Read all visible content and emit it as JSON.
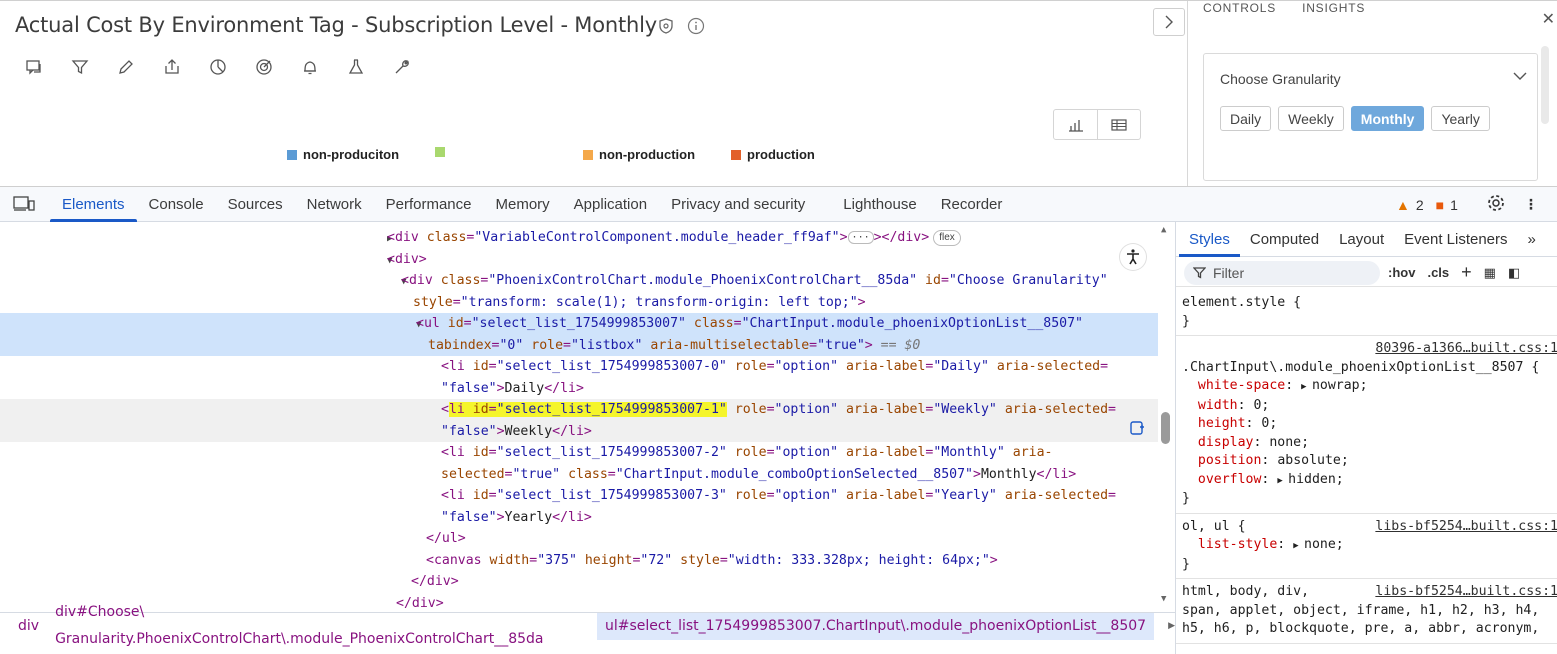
{
  "app": {
    "title": "Actual Cost By Environment Tag - Subscription Level - Monthly",
    "title_icons": [
      "shield-icon",
      "info-icon"
    ],
    "toolbar_icons": [
      "comment-icon",
      "filter-icon",
      "pencil-icon",
      "share-icon",
      "pie-chart-icon",
      "target-icon",
      "bell-icon",
      "flask-icon",
      "wrench-icon"
    ],
    "view_toggle": [
      "bar-chart-icon",
      "table-icon"
    ],
    "legend": [
      {
        "label": "non-produciton",
        "color": "#5b9bd5"
      },
      {
        "label": "",
        "color": "#a9d86e"
      },
      {
        "label": "non-production",
        "color": "#f4a84a"
      },
      {
        "label": "production",
        "color": "#e2602a"
      }
    ]
  },
  "side_panel": {
    "tabs": [
      "CONTROLS",
      "INSIGHTS"
    ],
    "granularity": {
      "label": "Choose Granularity",
      "options": [
        "Daily",
        "Weekly",
        "Monthly",
        "Yearly"
      ],
      "selected": "Monthly"
    }
  },
  "devtools": {
    "tabs": [
      "Elements",
      "Console",
      "Sources",
      "Network",
      "Performance",
      "Memory",
      "Application",
      "Privacy and security",
      "Lighthouse",
      "Recorder"
    ],
    "active_tab": "Elements",
    "warnings": "2",
    "issues": "1",
    "dom": {
      "l1_tag_open": "<div ",
      "l1_attr": "class",
      "l1_val": "\"VariableControlComponent.module_header_ff9af\"",
      "l1_close": "></div>",
      "l1_badge": "flex",
      "l2": "<div>",
      "l3_tag": "<div ",
      "l3_a1": "class",
      "l3_v1": "\"PhoenixControlChart.module_PhoenixControlChart__85da\"",
      "l3_a2": " id",
      "l3_v2": "\"Choose Granularity\"",
      "l4_a": "style",
      "l4_v": "\"transform: scale(1); transform-origin: left top;\"",
      "l5_tag": "<ul ",
      "l5_a1": "id",
      "l5_v1": "\"select_list_1754999853007\"",
      "l5_a2": " class",
      "l5_v2": "\"ChartInput.module_phoenixOptionList__8507\"",
      "l6_a1": "tabindex",
      "l6_v1": "\"0\"",
      "l6_a2": " role",
      "l6_v2": "\"listbox\"",
      "l6_a3": " aria-multiselectable",
      "l6_v3": "\"true\"",
      "l6_sel": " == $0",
      "li0_id": "\"select_list_1754999853007-0\"",
      "li0_label": "\"Daily\"",
      "li0_text": "Daily",
      "li1_id": "\"select_list_1754999853007-1\"",
      "li1_label": "\"Weekly\"",
      "li1_text": "Weekly",
      "li2_id": "\"select_list_1754999853007-2\"",
      "li2_label": "\"Monthly\"",
      "li2_class": "\"ChartInput.module_comboOptionSelected__8507\"",
      "li2_text": "Monthly",
      "li3_id": "\"select_list_1754999853007-3\"",
      "li3_label": "\"Yearly\"",
      "li3_text": "Yearly",
      "false_val": "\"false\"",
      "true_val": "\"true\"",
      "option_val": "\"option\"",
      "canvas_w": "\"375\"",
      "canvas_h": "\"72\"",
      "canvas_style": "\"width: 333.328px; height: 64px;\""
    },
    "breadcrumbs": [
      "div",
      "div#Choose\\ Granularity.PhoenixControlChart\\.module_PhoenixControlChart__85da",
      "ul#select_list_1754999853007.ChartInput\\.module_phoenixOptionList__8507"
    ],
    "styles_tabs": [
      "Styles",
      "Computed",
      "Layout",
      "Event Listeners"
    ],
    "filter_placeholder": "Filter",
    "filter_tools": [
      ":hov",
      ".cls"
    ],
    "rules": {
      "r1_selector": "element.style {",
      "r2_src": "80396-a1366…built.css:1",
      "r2_selector": ".ChartInput\\.module_phoenixOptionList__8507 {",
      "r2_props": [
        {
          "n": "white-space",
          "v": "nowrap;",
          "tri": true
        },
        {
          "n": "width",
          "v": "0;",
          "tri": false
        },
        {
          "n": "height",
          "v": "0;",
          "tri": false
        },
        {
          "n": "display",
          "v": "none;",
          "tri": false
        },
        {
          "n": "position",
          "v": "absolute;",
          "tri": false
        },
        {
          "n": "overflow",
          "v": "hidden;",
          "tri": true
        }
      ],
      "r3_src": "libs-bf5254…built.css:1",
      "r3_selector": "ol, ul {",
      "r3_prop_n": "list-style",
      "r3_prop_v": "none;",
      "r4_src": "libs-bf5254…built.css:1",
      "r4_l1": "html, body, div,",
      "r4_l2": "span, applet, object, iframe, h1, h2, h3, h4,",
      "r4_l3": "h5, h6, p, blockquote, pre, a, abbr, acronym,"
    }
  }
}
